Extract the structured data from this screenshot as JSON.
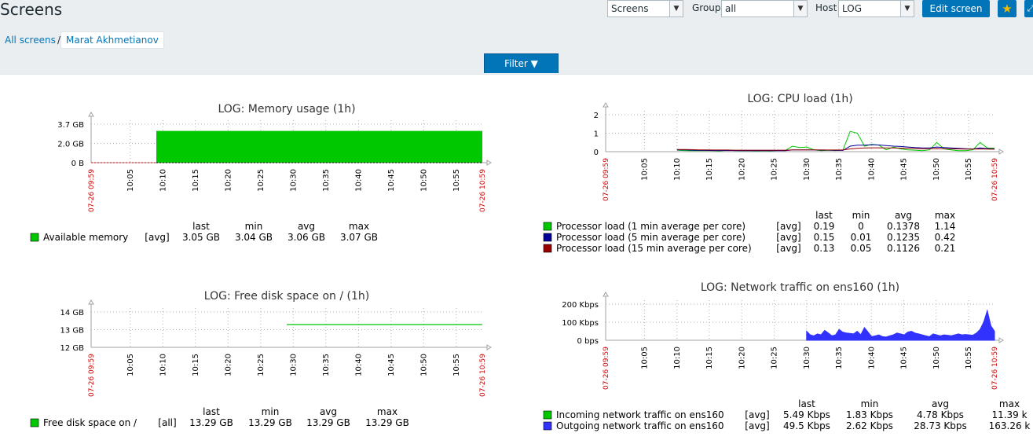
{
  "page": {
    "title": "Screens"
  },
  "toolbar": {
    "screens_value": "Screens",
    "group_label": "Group",
    "group_value": "all",
    "host_label": "Host",
    "host_value": "LOG",
    "edit_label": "Edit screen"
  },
  "breadcrumb": {
    "root": "All screens",
    "sep": "/",
    "current": "Marat Akhmetianov"
  },
  "filter": {
    "label": "Filter ▼"
  },
  "colors": {
    "accent": "#0275b8",
    "green": "#00c800",
    "blue": "#3232ff",
    "dark_blue": "#000099",
    "dark_red": "#990000",
    "red_label": "#cc0000"
  },
  "legend_headers": [
    "last",
    "min",
    "avg",
    "max"
  ],
  "chart_data": [
    {
      "id": "memory",
      "type": "area",
      "title": "LOG: Memory usage (1h)",
      "y_ticks": [
        "3.7 GB",
        "2.0 GB",
        "0 B"
      ],
      "x_ticks": [
        "10:05",
        "10:10",
        "10:15",
        "10:20",
        "10:25",
        "10:30",
        "10:35",
        "10:40",
        "10:45",
        "10:50",
        "10:55"
      ],
      "x_start": "07-26 09:59",
      "x_end": "07-26 10:59",
      "series": [
        {
          "name": "Available memory",
          "func": "[avg]",
          "color": "#00c800",
          "last": "3.05 GB",
          "min": "3.04 GB",
          "avg": "3.06 GB",
          "max": "3.07 GB",
          "from": "10:09",
          "values_gb": [
            3.05
          ]
        }
      ]
    },
    {
      "id": "disk",
      "type": "line",
      "title": "LOG: Free disk space on / (1h)",
      "y_ticks": [
        "14 GB",
        "13 GB",
        "12 GB"
      ],
      "x_ticks": [
        "10:05",
        "10:10",
        "10:15",
        "10:20",
        "10:25",
        "10:30",
        "10:35",
        "10:40",
        "10:45",
        "10:50",
        "10:55"
      ],
      "x_start": "07-26 09:59",
      "x_end": "07-26 10:59",
      "series": [
        {
          "name": "Free disk space on /",
          "func": "[all]",
          "color": "#00c800",
          "last": "13.29 GB",
          "min": "13.29 GB",
          "avg": "13.29 GB",
          "max": "13.29 GB",
          "from": "10:29",
          "values_gb": [
            13.29
          ]
        }
      ]
    },
    {
      "id": "cpu",
      "type": "line",
      "title": "LOG: CPU load (1h)",
      "y_ticks": [
        "2",
        "1",
        "0"
      ],
      "x_ticks": [
        "10:05",
        "10:10",
        "10:15",
        "10:20",
        "10:25",
        "10:30",
        "10:35",
        "10:40",
        "10:45",
        "10:50",
        "10:55"
      ],
      "x_start": "07-26 09:59",
      "x_end": "07-26 10:59",
      "series": [
        {
          "name": "Processor load (1 min average per core)",
          "func": "[avg]",
          "color": "#00c800",
          "last": "0.19",
          "min": "0",
          "avg": "0.1378",
          "max": "1.14",
          "values": [
            0.08,
            0.06,
            0.05,
            0.05,
            0.06,
            0.05,
            0.04,
            0.09,
            0.05,
            0.06,
            0.05,
            0.04,
            0.05,
            0.04,
            0.07,
            0.06,
            0.3,
            0.22,
            0.25,
            0.1,
            0.05,
            0.08,
            0.06,
            0.1,
            1.1,
            1.0,
            0.3,
            0.4,
            0.35,
            0.1,
            0.25,
            0.15,
            0.1,
            0.08,
            0.05,
            0.1,
            0.5,
            0.15,
            0.1,
            0.05,
            0.05,
            0.1,
            0.5,
            0.2,
            0.19
          ]
        },
        {
          "name": "Processor load (5 min average per core)",
          "func": "[avg]",
          "color": "#000099",
          "last": "0.15",
          "min": "0.01",
          "avg": "0.1235",
          "max": "0.42",
          "values": [
            0.1,
            0.1,
            0.08,
            0.07,
            0.07,
            0.06,
            0.06,
            0.06,
            0.06,
            0.05,
            0.05,
            0.05,
            0.05,
            0.05,
            0.05,
            0.05,
            0.1,
            0.1,
            0.1,
            0.1,
            0.08,
            0.08,
            0.07,
            0.07,
            0.3,
            0.35,
            0.35,
            0.38,
            0.36,
            0.33,
            0.3,
            0.28,
            0.25,
            0.22,
            0.2,
            0.2,
            0.25,
            0.22,
            0.2,
            0.18,
            0.16,
            0.15,
            0.2,
            0.17,
            0.15
          ]
        },
        {
          "name": "Processor load (15 min average per core)",
          "func": "[avg]",
          "color": "#990000",
          "last": "0.13",
          "min": "0.05",
          "avg": "0.1126",
          "max": "0.21",
          "values": [
            0.12,
            0.12,
            0.11,
            0.1,
            0.1,
            0.09,
            0.09,
            0.09,
            0.08,
            0.08,
            0.08,
            0.08,
            0.08,
            0.08,
            0.08,
            0.08,
            0.1,
            0.1,
            0.1,
            0.1,
            0.1,
            0.09,
            0.09,
            0.09,
            0.15,
            0.18,
            0.2,
            0.21,
            0.21,
            0.2,
            0.2,
            0.19,
            0.18,
            0.17,
            0.16,
            0.16,
            0.17,
            0.16,
            0.15,
            0.15,
            0.14,
            0.14,
            0.15,
            0.14,
            0.13
          ]
        }
      ]
    },
    {
      "id": "network",
      "type": "area",
      "title": "LOG: Network traffic on ens160 (1h)",
      "y_ticks": [
        "200 Kbps",
        "100 Kbps",
        "0 bps"
      ],
      "x_ticks": [
        "10:05",
        "10:10",
        "10:15",
        "10:20",
        "10:25",
        "10:30",
        "10:35",
        "10:40",
        "10:45",
        "10:50",
        "10:55"
      ],
      "x_start": "07-26 09:59",
      "x_end": "07-26 10:59",
      "series": [
        {
          "name": "Incoming network traffic on ens160",
          "func": "[avg]",
          "color": "#00c800",
          "last": "5.49 Kbps",
          "min": "1.83 Kbps",
          "avg": "4.78 Kbps",
          "max": "11.39 k"
        },
        {
          "name": "Outgoing network traffic on ens160",
          "func": "[avg]",
          "color": "#3232ff",
          "last": "49.5 Kbps",
          "min": "2.62 Kbps",
          "avg": "28.73 Kbps",
          "max": "163.26 k",
          "from": "10:30",
          "values_kbps": [
            50,
            30,
            25,
            35,
            30,
            55,
            40,
            25,
            30,
            60,
            45,
            40,
            38,
            35,
            50,
            30,
            70,
            45,
            20,
            25,
            30,
            20,
            18,
            25,
            30,
            40,
            35,
            30,
            45,
            50,
            40,
            35,
            30,
            25,
            20,
            35,
            30,
            25,
            30,
            28,
            25,
            30,
            35,
            30,
            32,
            30,
            28,
            40,
            60,
            100,
            165,
            80,
            50
          ]
        }
      ]
    }
  ]
}
